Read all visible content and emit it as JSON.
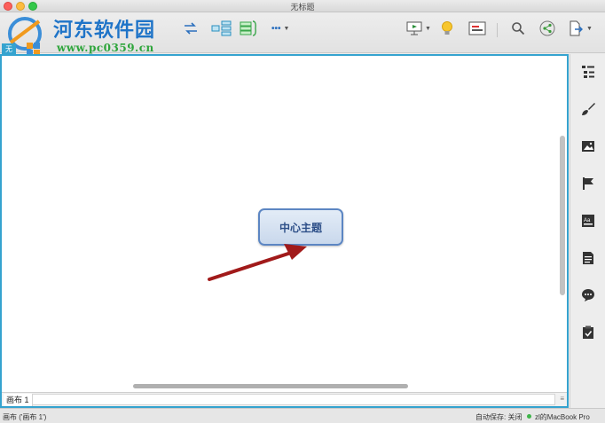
{
  "window": {
    "title": "无标题"
  },
  "watermark": {
    "site_name": "河东软件园",
    "url": "www.pc0359.cn"
  },
  "canvas": {
    "tab_label": "无",
    "central_topic": "中心主题",
    "sheet_tab": "画布 1"
  },
  "toolbar": {
    "items": [
      {
        "name": "relationship",
        "icon": "relationship-icon"
      },
      {
        "name": "structure",
        "icon": "structure-icon"
      },
      {
        "name": "more",
        "icon": "more-icon",
        "label": "•••"
      },
      {
        "name": "presentation",
        "icon": "presentation-icon"
      },
      {
        "name": "brainstorm",
        "icon": "lightbulb-icon"
      },
      {
        "name": "gantt",
        "icon": "gantt-icon"
      },
      {
        "name": "search",
        "icon": "search-icon"
      },
      {
        "name": "share",
        "icon": "share-icon"
      },
      {
        "name": "export",
        "icon": "export-icon"
      }
    ]
  },
  "sidebar": {
    "items": [
      {
        "name": "outline",
        "icon": "outline-icon"
      },
      {
        "name": "format",
        "icon": "brush-icon"
      },
      {
        "name": "image",
        "icon": "image-icon"
      },
      {
        "name": "marker",
        "icon": "flag-icon"
      },
      {
        "name": "style",
        "icon": "text-style-icon"
      },
      {
        "name": "notes",
        "icon": "notes-icon"
      },
      {
        "name": "comments",
        "icon": "comment-icon"
      },
      {
        "name": "task",
        "icon": "clipboard-icon"
      }
    ]
  },
  "status": {
    "left": "画布 ('画布 1')",
    "autosave": "自动保存: 关闭",
    "device": "zl的MacBook Pro"
  },
  "colors": {
    "canvas_border": "#35a3cf",
    "topic_border": "#5c86c3",
    "arrow": "#a11a1a",
    "watermark_text": "#1f74c8",
    "watermark_url": "#2ea53b"
  }
}
